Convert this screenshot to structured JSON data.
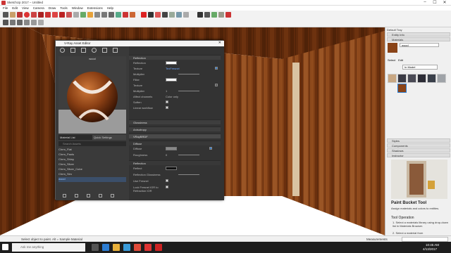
{
  "window": {
    "title": "SketchUp 2017 – Untitled",
    "minimize": "–",
    "maximize": "☐",
    "close": "✕"
  },
  "menubar": [
    "File",
    "Edit",
    "View",
    "Camera",
    "Draw",
    "Tools",
    "Window",
    "Extensions",
    "Help"
  ],
  "asset_editor": {
    "title": "V-Ray Asset Editor",
    "preview_label": "wood",
    "tabs": [
      "Material List",
      "Quick Settings"
    ],
    "search_placeholder": "Search Assets",
    "materials": [
      "Chrm_Flat",
      "Chrm_Panls",
      "Chrm_Shiny",
      "Chrm_Silver",
      "Chrm_Silver_Cube",
      "Chrm_Sim",
      "wood"
    ],
    "sections": {
      "reflection": "Reflection",
      "glossiness": "Glossiness",
      "anisotropy": "Anisotropy",
      "vraybrdf": "VRayBRDF",
      "diffuse": "Diffuse",
      "reflection2": "Reflection"
    },
    "rows": {
      "reflection": "Reflection",
      "texture": "Texture",
      "texture_value": "TexFresnel",
      "multiplier": "Multiplier",
      "filter": "Filter",
      "texture2": "Texture",
      "multiplier2": "Multiplier",
      "affect_channels": "Affect channels",
      "affect_value": "Color only",
      "soften": "Soften",
      "linear_workflow": "Linear workflow",
      "diffuse": "Diffuse",
      "roughness": "Roughness",
      "reflect": "Reflect",
      "refl_glossiness": "Reflection Glossiness",
      "use_fresnel": "Use Fresnel",
      "lock_fresnel": "Lock Fresnel IOR to Refraction IOR"
    },
    "values": {
      "roughness": "0",
      "multiplier2": "1"
    }
  },
  "tray": {
    "title": "Default Tray",
    "panels": [
      "Entity Info",
      "Materials"
    ],
    "material_name": "wood",
    "tabs": [
      "Select",
      "Edit"
    ],
    "dropdown": "In Model",
    "collapsed": [
      "Styles",
      "Components",
      "Shadows",
      "Instructor"
    ],
    "instructor_title": "Paint Bucket Tool",
    "instructor_sub": "Assign materials and colors to entities.",
    "tool_op": "Tool Operation",
    "step1": "1. Select a materials library using drop-down list in Materials Browser.",
    "step2": "2. Select a material from"
  },
  "status": {
    "text": "Select object to paint. Alt = Sample Material",
    "measurements": "Measurements"
  },
  "taskbar": {
    "search": "Ask me anything",
    "time": "10:45 AM",
    "date": "4/13/2017"
  },
  "colors": {
    "wood": "#8a4418",
    "accent": "#2d7dd2",
    "editor_bg": "#2f2f2f"
  }
}
